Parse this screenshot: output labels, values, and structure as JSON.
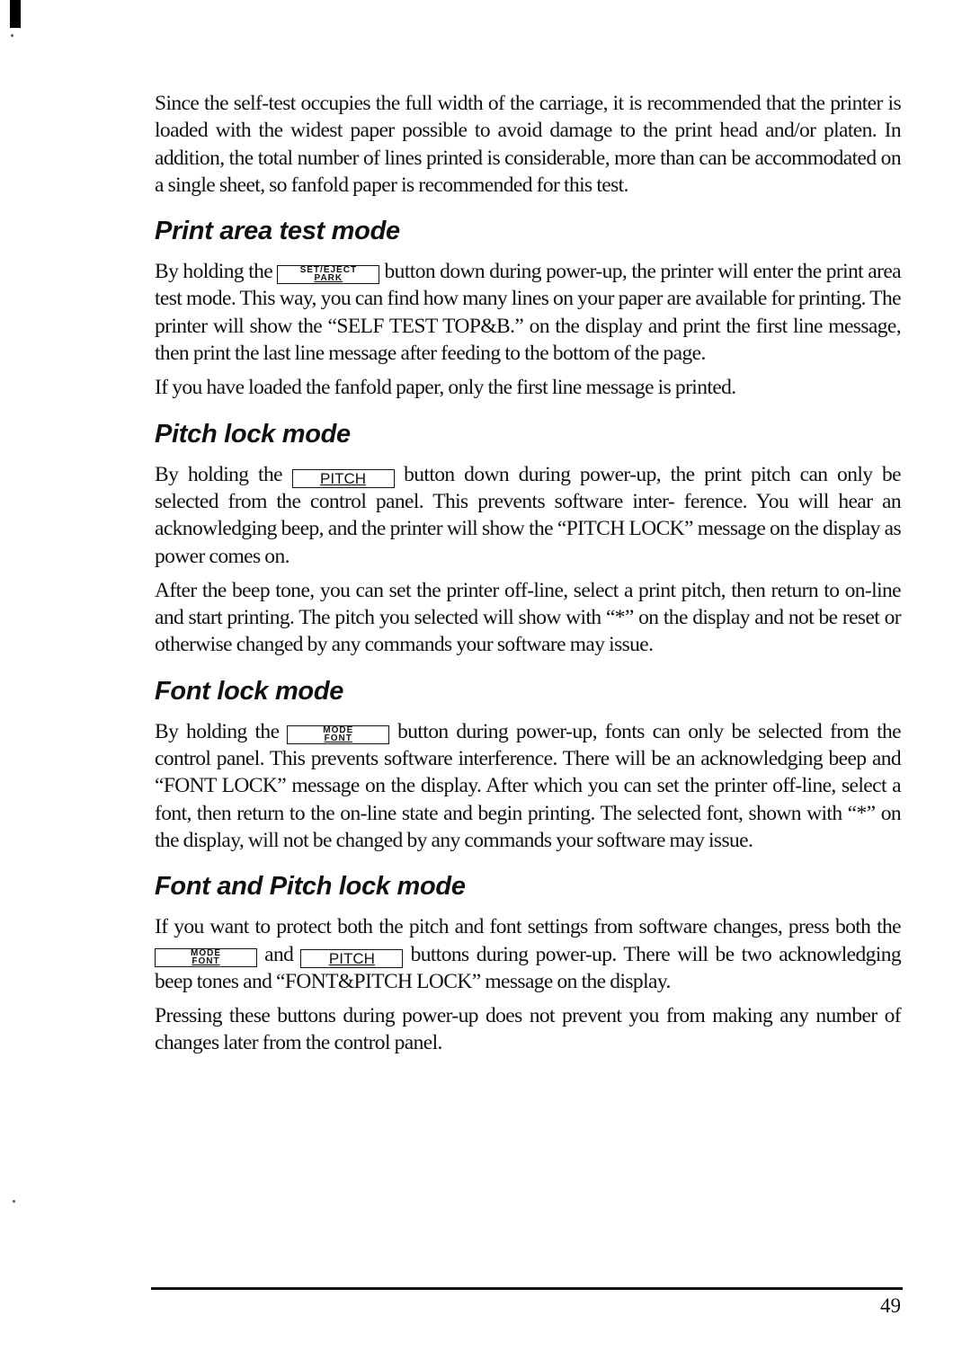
{
  "intro": {
    "paragraph": "Since the self-test occupies the full width of the carriage, it is recommended that the printer is loaded with the widest paper possible to avoid damage to the print head and/or platen. In addition, the total number of lines printed is considerable, more than can be accommodated on a single sheet, so fanfold paper is recommended for this test."
  },
  "keys": {
    "set_eject_park": {
      "top": "SET/EJECT",
      "bottom": "PARK"
    },
    "pitch": "PITCH",
    "mode_font": {
      "top": "MODE",
      "bottom": "FONT"
    }
  },
  "sections": [
    {
      "title": "Print area test mode",
      "p1_before": "By holding the",
      "p1_after": "button down during power-up, the printer will enter the print area test mode. This way, you can find how many lines on your paper are available for printing. The printer will show the “SELF TEST TOP&B.” on the display and print the first line message, then print the last line message after feeding to the bottom of the page.",
      "p2": "If you have loaded the fanfold paper, only the first line message is printed."
    },
    {
      "title": "Pitch lock mode",
      "p1_before": "By holding the",
      "p1_after": "button down during power-up, the print pitch can only be selected from the control panel. This prevents software inter- ference. You will hear an acknowledging beep, and the printer will show the “PITCH LOCK” message on the display as power comes on.",
      "p2": "After the beep tone, you can set the printer off-line, select a print pitch, then return to on-line and start printing. The pitch you selected will show with “*” on the display and not be reset or otherwise changed by any commands your software may issue."
    },
    {
      "title": "Font lock mode",
      "p1_before": "By holding the",
      "p1_after": "button during power-up, fonts can only be selected from the control panel. This prevents software interference. There will be an acknowledging beep and “FONT LOCK” message on the display. After which you can set the printer off-line, select a font, then return to the on-line state and begin printing. The selected font, shown with “*” on the display, will not be changed by any commands your software may issue."
    },
    {
      "title": "Font and Pitch lock mode",
      "p1_before": "If you want to protect both the pitch and font settings from software changes, press both the",
      "p1_middle": "and",
      "p1_after": "buttons during power-up. There will be two acknowledging beep tones and “FONT&PITCH LOCK” message on the display.",
      "p2": "Pressing these buttons during power-up does not prevent you from making any number of changes later from the control panel."
    }
  ],
  "footer": {
    "page_number": "49"
  }
}
